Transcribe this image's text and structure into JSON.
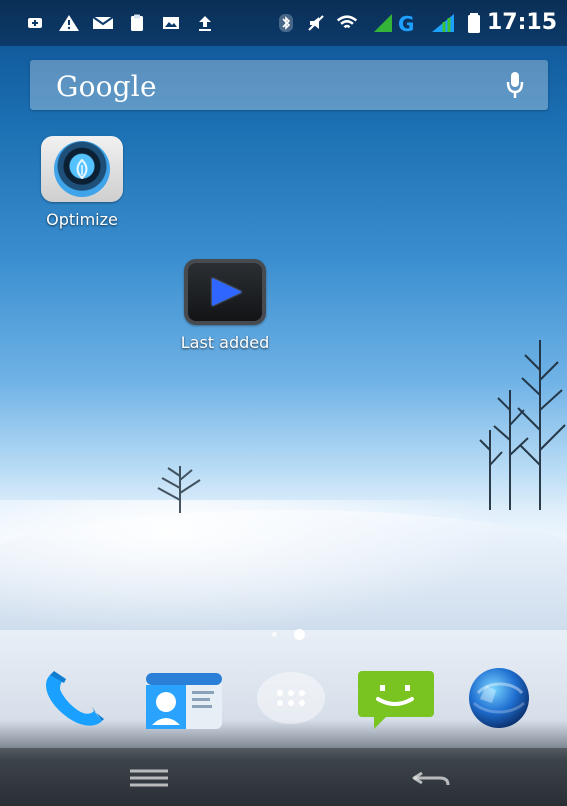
{
  "status_bar": {
    "time": "17:15",
    "icons": [
      "plus-badge-icon",
      "warning-icon",
      "mail-icon",
      "clipboard-icon",
      "image-icon",
      "upload-icon",
      "bluetooth-icon",
      "mute-icon",
      "wifi-icon",
      "signal-g-icon",
      "signal-icon",
      "battery-icon"
    ]
  },
  "search": {
    "label": "Google",
    "mic_icon": "mic-icon"
  },
  "apps": [
    {
      "label": "Optimize",
      "icon": "optimize-icon"
    },
    {
      "label": "Last added",
      "icon": "play-icon"
    }
  ],
  "page_indicator": {
    "pages": 2,
    "current": 2
  },
  "dock": [
    {
      "icon": "phone-icon"
    },
    {
      "icon": "contacts-icon"
    },
    {
      "icon": "app-drawer-icon"
    },
    {
      "icon": "messaging-icon"
    },
    {
      "icon": "browser-globe-icon"
    }
  ],
  "nav_bar": {
    "left_icon": "menu-icon",
    "right_icon": "back-icon"
  },
  "colors": {
    "accent": "#2f66ff",
    "status_green": "#39c234",
    "status_blue": "#1ea0ff"
  }
}
